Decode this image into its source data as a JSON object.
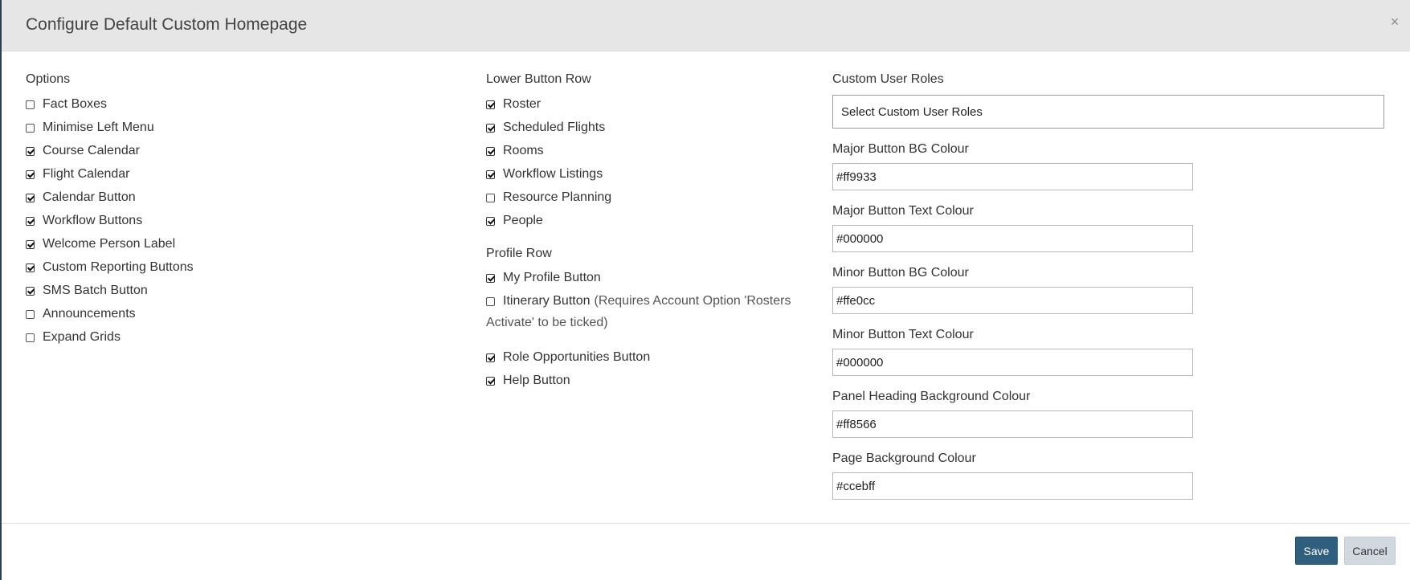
{
  "modal": {
    "title": "Configure Default Custom Homepage",
    "close_label": "×"
  },
  "options": {
    "heading": "Options",
    "items": [
      {
        "label": "Fact Boxes",
        "checked": false
      },
      {
        "label": "Minimise Left Menu",
        "checked": false
      },
      {
        "label": "Course Calendar",
        "checked": true
      },
      {
        "label": "Flight Calendar",
        "checked": true
      },
      {
        "label": "Calendar Button",
        "checked": true
      },
      {
        "label": "Workflow Buttons",
        "checked": true
      },
      {
        "label": "Welcome Person Label",
        "checked": true
      },
      {
        "label": "Custom Reporting Buttons",
        "checked": true
      },
      {
        "label": "SMS Batch Button",
        "checked": true
      },
      {
        "label": "Announcements",
        "checked": false
      },
      {
        "label": "Expand Grids",
        "checked": false
      }
    ]
  },
  "lower_button_row": {
    "heading": "Lower Button Row",
    "items": [
      {
        "label": "Roster",
        "checked": true
      },
      {
        "label": "Scheduled Flights",
        "checked": true
      },
      {
        "label": "Rooms",
        "checked": true
      },
      {
        "label": "Workflow Listings",
        "checked": true
      },
      {
        "label": "Resource Planning",
        "checked": false
      },
      {
        "label": "People",
        "checked": true
      }
    ]
  },
  "profile_row": {
    "heading": "Profile Row",
    "my_profile": {
      "label": "My Profile Button",
      "checked": true
    },
    "itinerary": {
      "label": "Itinerary Button",
      "note_part1": "(Requires Account Option 'Rosters",
      "note_part2": "Activate' to be ticked)",
      "checked": false
    },
    "role_opportunities": {
      "label": "Role Opportunities Button",
      "checked": true
    },
    "help": {
      "label": "Help Button",
      "checked": true
    }
  },
  "custom_roles": {
    "label": "Custom User Roles",
    "placeholder": "Select Custom User Roles"
  },
  "colours": [
    {
      "label": "Major Button BG Colour",
      "value": "#ff9933"
    },
    {
      "label": "Major Button Text Colour",
      "value": "#000000"
    },
    {
      "label": "Minor Button BG Colour",
      "value": "#ffe0cc"
    },
    {
      "label": "Minor Button Text Colour",
      "value": "#000000"
    },
    {
      "label": "Panel Heading Background Colour",
      "value": "#ff8566"
    },
    {
      "label": "Page Background Colour",
      "value": "#ccebff"
    }
  ],
  "footer": {
    "save_label": "Save",
    "cancel_label": "Cancel"
  },
  "theme": {
    "save_color": "#2f5f7f",
    "cancel_color": "#d2d8df",
    "header_bg": "#e6e6e6"
  }
}
